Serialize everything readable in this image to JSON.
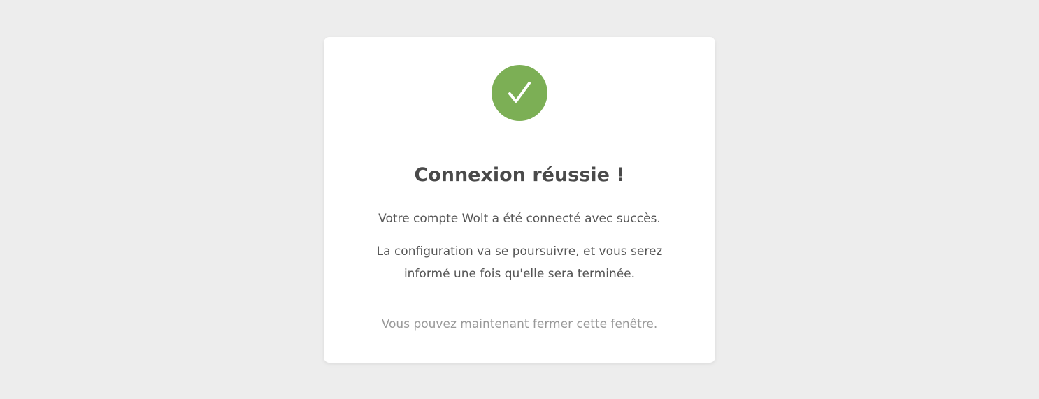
{
  "colors": {
    "background": "#ededed",
    "card": "#ffffff",
    "success": "#7caf55",
    "title": "#4a4a4a",
    "text": "#555555",
    "muted": "#999999"
  },
  "icon": "checkmark-icon",
  "title": "Connexion réussie !",
  "messages": {
    "connected": "Votre compte Wolt a été connecté avec succès.",
    "configuration": "La configuration va se poursuivre, et vous serez informé une fois qu'elle sera terminée.",
    "close_hint": "Vous pouvez maintenant fermer cette fenêtre."
  }
}
